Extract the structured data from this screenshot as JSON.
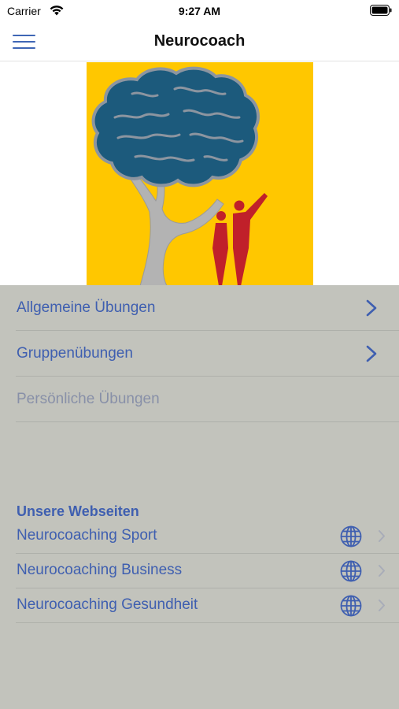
{
  "status_bar": {
    "carrier": "Carrier",
    "time": "9:27 AM"
  },
  "nav": {
    "title": "Neurocoach",
    "menu_icon": "hamburger-icon"
  },
  "hero": {
    "image": "brain-tree-logo",
    "background_color": "#ffc700"
  },
  "menu": {
    "items": [
      {
        "label": "Allgemeine Übungen",
        "enabled": true,
        "icon": "chevron-right-icon"
      },
      {
        "label": "Gruppenübungen",
        "enabled": true,
        "icon": "chevron-right-icon"
      },
      {
        "label": "Persönliche Übungen",
        "enabled": false
      }
    ]
  },
  "websites": {
    "header": "Unsere Webseiten",
    "items": [
      {
        "label": "Neurocoaching Sport",
        "icon": "globe-icon"
      },
      {
        "label": "Neurocoaching Business",
        "icon": "globe-icon"
      },
      {
        "label": "Neurocoaching Gesundheit",
        "icon": "globe-icon"
      }
    ]
  },
  "colors": {
    "accent": "#3f5fb0",
    "overlay": "#c2c3bc",
    "logo_yellow": "#ffc700",
    "brain_blue": "#1c5a7c",
    "figure_red": "#c0202a"
  }
}
